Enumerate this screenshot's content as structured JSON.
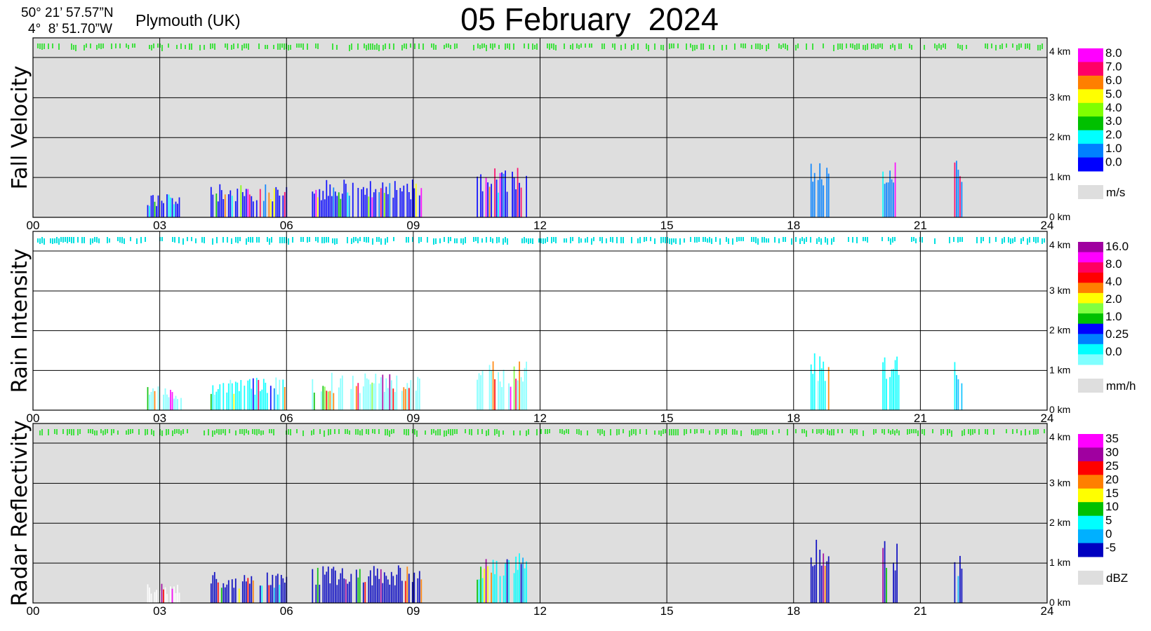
{
  "header": {
    "latitude": "50° 21’ 57.57”N",
    "longitude": "4°  8’ 51.70”W",
    "location": "Plymouth (UK)",
    "date": "05 February  2024"
  },
  "x_ticks": [
    "00",
    "03",
    "06",
    "09",
    "12",
    "15",
    "18",
    "21",
    "24"
  ],
  "height_ticks": [
    "0 km",
    "1 km",
    "2 km",
    "3 km",
    "4 km"
  ],
  "colors": {
    "panel_gray": "#dedede",
    "panel_white": "#ffffff",
    "grid": "#000000"
  },
  "chart_data": [
    {
      "type": "heatmap",
      "title": "Fall Velocity",
      "xlabel": "",
      "ylabel": "Fall Velocity",
      "x_range": [
        0,
        24
      ],
      "y_range_km": [
        0,
        4.5
      ],
      "background": "#dedede",
      "colorbar": {
        "unit": "m/s",
        "labels": [
          "8.0",
          "7.0",
          "6.0",
          "5.0",
          "4.0",
          "3.0",
          "2.0",
          "1.0",
          "0.0"
        ],
        "colors": [
          "#ff00ff",
          "#ff0066",
          "#ff7f00",
          "#ffff00",
          "#80ff00",
          "#00c000",
          "#00ffff",
          "#0080ff",
          "#0000ff"
        ],
        "nodata_color": "#dedede"
      },
      "echo_blocks": [
        {
          "start_h": 2.7,
          "end_h": 3.5,
          "top_km": 0.6,
          "dominant": "#0000ff"
        },
        {
          "start_h": 4.2,
          "end_h": 6.0,
          "top_km": 0.85,
          "dominant": "#0000ff"
        },
        {
          "start_h": 6.6,
          "end_h": 9.2,
          "top_km": 0.95,
          "dominant": "#0000ff"
        },
        {
          "start_h": 10.5,
          "end_h": 11.7,
          "top_km": 1.25,
          "dominant": "#0000ff"
        },
        {
          "start_h": 18.4,
          "end_h": 18.9,
          "top_km": 1.6,
          "dominant": "#0080ff"
        },
        {
          "start_h": 20.1,
          "end_h": 20.5,
          "top_km": 1.55,
          "dominant": "#0080ff"
        },
        {
          "start_h": 21.8,
          "end_h": 22.0,
          "top_km": 1.45,
          "dominant": "#0080ff"
        }
      ]
    },
    {
      "type": "heatmap",
      "title": "Rain Intensity",
      "xlabel": "",
      "ylabel": "Rain Intensity",
      "x_range": [
        0,
        24
      ],
      "y_range_km": [
        0,
        4.5
      ],
      "background": "#ffffff",
      "colorbar": {
        "unit": "mm/h",
        "labels": [
          "16.0",
          "8.0",
          "4.0",
          "2.0",
          "1.0",
          "0.25",
          "0.0"
        ],
        "colors": [
          "#a000a0",
          "#ff00ff",
          "#ff0060",
          "#ff0000",
          "#ff8000",
          "#ffff00",
          "#80ff40",
          "#00c000",
          "#0000ff",
          "#0080ff",
          "#00ffff",
          "#80ffff"
        ],
        "nodata_color": "#dedede"
      },
      "echo_blocks": [
        {
          "start_h": 2.7,
          "end_h": 3.5,
          "top_km": 0.6,
          "dominant": "#80ffff"
        },
        {
          "start_h": 4.2,
          "end_h": 6.0,
          "top_km": 0.85,
          "dominant": "#00ffff"
        },
        {
          "start_h": 6.6,
          "end_h": 9.2,
          "top_km": 0.95,
          "dominant": "#80ffff"
        },
        {
          "start_h": 10.5,
          "end_h": 11.7,
          "top_km": 1.25,
          "dominant": "#80ffff"
        },
        {
          "start_h": 18.4,
          "end_h": 18.9,
          "top_km": 1.6,
          "dominant": "#00ffff"
        },
        {
          "start_h": 20.1,
          "end_h": 20.5,
          "top_km": 1.55,
          "dominant": "#00ffff"
        },
        {
          "start_h": 21.8,
          "end_h": 22.0,
          "top_km": 1.45,
          "dominant": "#00c0ff"
        }
      ]
    },
    {
      "type": "heatmap",
      "title": "Radar Reflectivity",
      "xlabel": "",
      "ylabel": "Radar Reflectivity",
      "x_range": [
        0,
        24
      ],
      "y_range_km": [
        0,
        4.5
      ],
      "background": "#dedede",
      "colorbar": {
        "unit": "dBZ",
        "labels": [
          "35",
          "30",
          "25",
          "20",
          "15",
          "10",
          "5",
          "0",
          "-5"
        ],
        "colors": [
          "#ff00ff",
          "#a000a0",
          "#ff0000",
          "#ff7f00",
          "#ffff00",
          "#00c000",
          "#00ffff",
          "#00b0ff",
          "#0000c0"
        ],
        "nodata_color": "#dedede"
      },
      "echo_blocks": [
        {
          "start_h": 2.7,
          "end_h": 3.5,
          "top_km": 0.5,
          "dominant": "#ffffff"
        },
        {
          "start_h": 4.2,
          "end_h": 6.0,
          "top_km": 0.8,
          "dominant": "#0000c0"
        },
        {
          "start_h": 6.6,
          "end_h": 9.2,
          "top_km": 0.95,
          "dominant": "#0000c0"
        },
        {
          "start_h": 10.5,
          "end_h": 11.7,
          "top_km": 1.25,
          "dominant": "#00ffff"
        },
        {
          "start_h": 18.4,
          "end_h": 18.9,
          "top_km": 1.6,
          "dominant": "#0000c0"
        },
        {
          "start_h": 20.1,
          "end_h": 20.5,
          "top_km": 1.55,
          "dominant": "#0000c0"
        },
        {
          "start_h": 21.8,
          "end_h": 22.0,
          "top_km": 1.45,
          "dominant": "#0000c0"
        }
      ]
    }
  ]
}
